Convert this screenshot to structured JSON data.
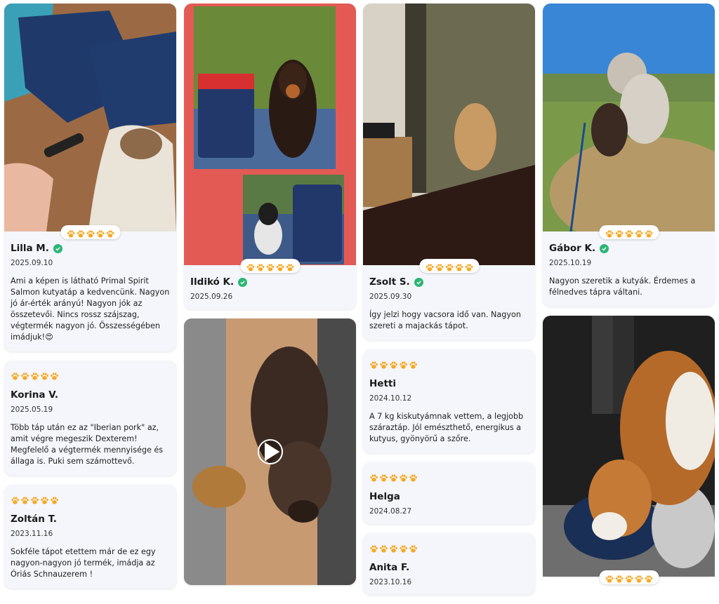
{
  "accent_color": "#f7a823",
  "verified_color": "#2bb673",
  "icons": {
    "rating": "paw-icon",
    "verified": "check-circle-icon",
    "video": "play-icon"
  },
  "reviews": [
    {
      "name": "Lilla M.",
      "verified": true,
      "rating": 5,
      "date": "2025.09.10",
      "text": "Ami a képen is látható Primal Spirit Salmon kutyatáp a kedvencünk. Nagyon jó ár-érték arányú! Nagyon jók az összetevői. Nincs rossz szájszag, végtermék nagyon jó. Összességében imádjuk!😍"
    },
    {
      "name": "Korina V.",
      "verified": false,
      "rating": 5,
      "date": "2025.05.19",
      "text": "Több táp után ez az \"Iberian pork\" az, amit végre megeszik Dexterem! Megfelelő a végtermék mennyisége és állaga is. Puki sem számottevő."
    },
    {
      "name": "Zoltán T.",
      "verified": false,
      "rating": 5,
      "date": "2023.11.16",
      "text": "Sokféle tápot etettem már de ez egy nagyon-nagyon jó termék, imádja az Óriás Schnauzerem !"
    },
    {
      "name": "Ildikó K.",
      "verified": true,
      "rating": 5,
      "date": "2025.09.26",
      "text": ""
    },
    {
      "name": "Zsolt S.",
      "verified": true,
      "rating": 5,
      "date": "2025.09.30",
      "text": "Így jelzi hogy vacsora idő van. Nagyon szereti a majackás tápot."
    },
    {
      "name": "Hetti",
      "verified": false,
      "rating": 5,
      "date": "2024.10.12",
      "text": "A 7 kg kiskutyámnak vettem, a legjobb száraztáp. Jól emészthető, energikus a kutyus, gyönyörű a szőre."
    },
    {
      "name": "Helga",
      "verified": false,
      "rating": 5,
      "date": "2024.08.27",
      "text": ""
    },
    {
      "name": "Anita F.",
      "verified": false,
      "rating": 5,
      "date": "2023.10.16",
      "text": ""
    },
    {
      "name": "Gábor K.",
      "verified": true,
      "rating": 5,
      "date": "2025.10.19",
      "text": "Nagyon szeretik a kutyák. Érdemes a félnedves tápra váltani."
    }
  ]
}
